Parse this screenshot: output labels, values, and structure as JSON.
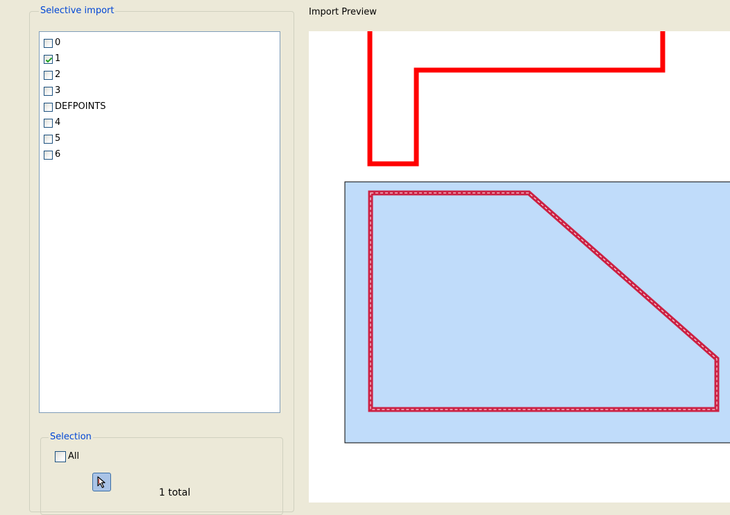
{
  "selective_import": {
    "title": "Selective import",
    "layers": [
      {
        "label": "0",
        "checked": false
      },
      {
        "label": "1",
        "checked": true
      },
      {
        "label": "2",
        "checked": false
      },
      {
        "label": "3",
        "checked": false
      },
      {
        "label": "DEFPOINTS",
        "checked": false
      },
      {
        "label": "4",
        "checked": false
      },
      {
        "label": "5",
        "checked": false
      },
      {
        "label": "6",
        "checked": false
      }
    ]
  },
  "selection": {
    "title": "Selection",
    "all_label": "All",
    "all_checked": false,
    "pick_icon": "cursor-arrow-icon",
    "total_text": "1 total"
  },
  "preview": {
    "title": "Import Preview",
    "colors": {
      "outline": "#ff0000",
      "selected_fill": "#c0dcfa",
      "selected_outline": "#cc2244",
      "frame": "#000000"
    }
  }
}
